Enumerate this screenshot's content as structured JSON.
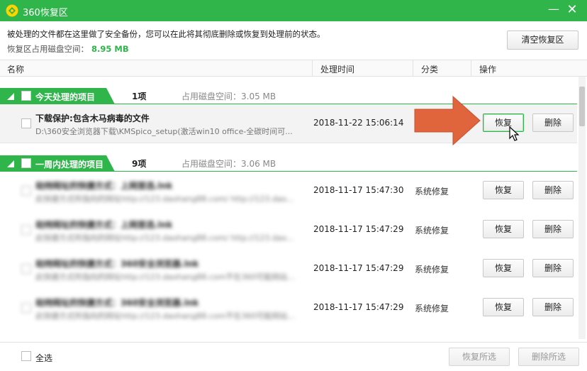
{
  "window": {
    "title": "360恢复区",
    "minimize_glyph": "—",
    "close_glyph": "✕"
  },
  "info": {
    "description": "被处理的文件都在这里做了安全备份，您可以在此将其彻底删除或恢复到处理前的状态。",
    "disk_label": "恢复区占用磁盘空间：",
    "disk_value": "8.95 MB",
    "clear_button": "清空恢复区"
  },
  "columns": {
    "name": "名称",
    "time": "处理时间",
    "category": "分类",
    "action": "操作"
  },
  "groups": [
    {
      "label": "今天处理的项目",
      "count": "1项",
      "disk": "占用磁盘空间：3.05 MB",
      "items": [
        {
          "name": "下载保护:包含木马病毒的文件",
          "path": "D:\\360安全浏览器下载\\KMSpico_setup(激活win10 office-全碳时间可...",
          "time": "2018-11-22 15:06:14",
          "category": "",
          "restore": "恢复",
          "delete": "删除"
        }
      ]
    },
    {
      "label": "一周内处理的项目",
      "count": "9项",
      "disk": "占用磁盘空间：3.06 MB",
      "items": [
        {
          "name": "劫持网址的快捷方式：上网首选.lnk",
          "path": "此快捷方式所指向的网址http://123.daohang88.com/ http://123.dao...",
          "time": "2018-11-17 15:47:30",
          "category": "系统修复",
          "restore": "恢复",
          "delete": "删除"
        },
        {
          "name": "劫持网址的快捷方式：上网首选.lnk",
          "path": "此快捷方式所指向的网址http://123.daohang88.com/ http://123.dao...",
          "time": "2018-11-17 15:47:29",
          "category": "系统修复",
          "restore": "恢复",
          "delete": "删除"
        },
        {
          "name": "劫持网址的快捷方式：360安全浏览器.lnk",
          "path": "此快捷方式所指向的网址http://123.daohang88.com不在360可能网站...",
          "time": "2018-11-17 15:47:29",
          "category": "系统修复",
          "restore": "恢复",
          "delete": "删除"
        },
        {
          "name": "劫持网址的快捷方式：360安全浏览器.lnk",
          "path": "此快捷方式所指向的网址http://123.daohang88.com不在360可能网站...",
          "time": "2018-11-17 15:47:29",
          "category": "系统修复",
          "restore": "恢复",
          "delete": "删除"
        }
      ]
    }
  ],
  "footer": {
    "select_all": "全选",
    "restore_selected": "恢复所选",
    "delete_selected": "删除所选"
  },
  "colors": {
    "accent": "#2fb54a",
    "arrow": "#e0643c"
  }
}
